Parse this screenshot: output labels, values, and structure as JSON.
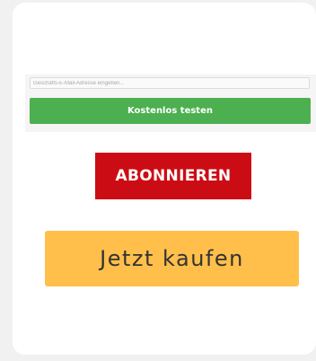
{
  "signup": {
    "email_placeholder": "Geschäfts-E-Mail-Adresse eingeben...",
    "trial_label": "Kostenlos testen"
  },
  "subscribe": {
    "label": "ABONNIEREN"
  },
  "buy": {
    "label": "Jetzt kaufen"
  },
  "colors": {
    "page_background": "#f1f1f1",
    "card_background": "#ffffff",
    "trial_button": "#4caf50",
    "subscribe_button": "#cc0c14",
    "buy_button": "#ffbf4a"
  }
}
